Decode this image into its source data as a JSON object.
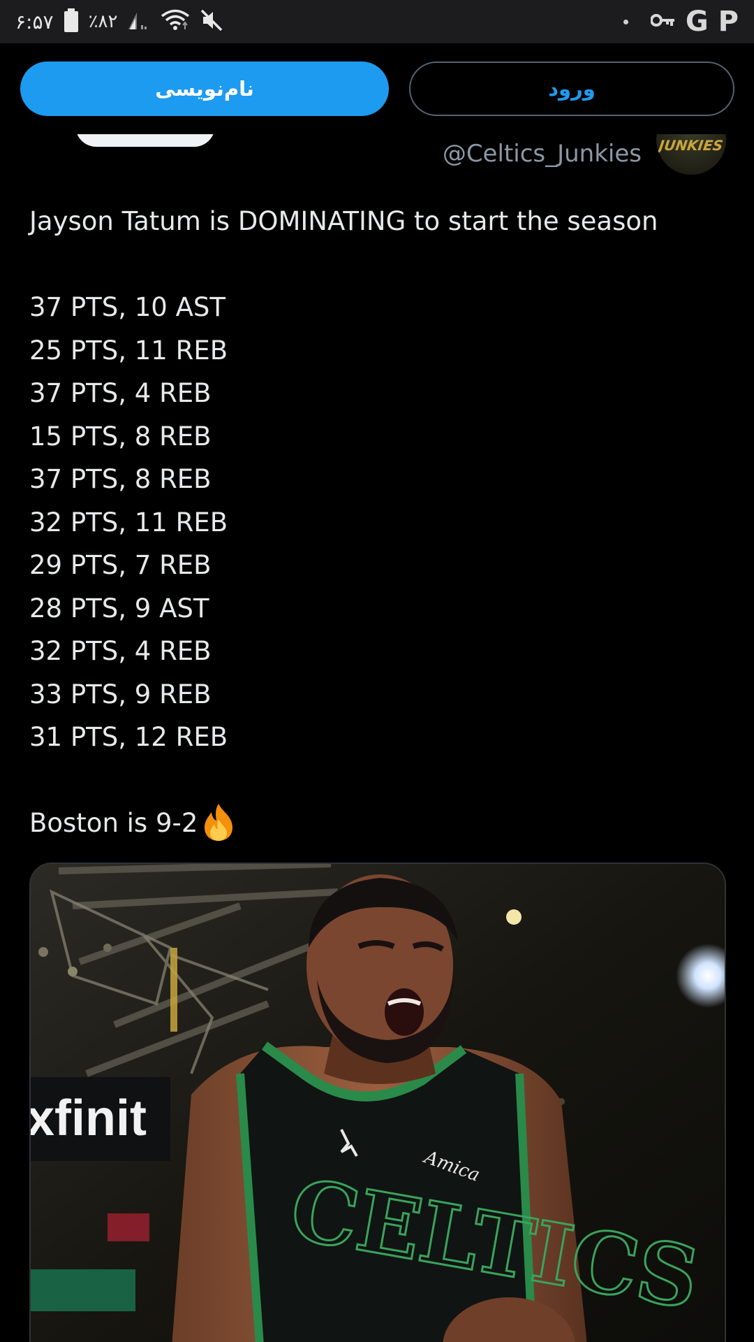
{
  "status_bar": {
    "time": "۶:۵۷",
    "battery_percent": "٪۸۲",
    "app_icons": [
      "key-icon",
      "g-letter-icon",
      "p-letter-icon"
    ],
    "g_letter": "G",
    "p_letter": "P"
  },
  "auth": {
    "signup_label": "نام‌نویسی",
    "login_label": "ورود"
  },
  "account": {
    "handle": "@Celtics_Junkies",
    "avatar_text": "JUNKIES"
  },
  "tweet": {
    "intro": "Jayson Tatum is DOMINATING to start the season",
    "stat_lines": [
      "37 PTS, 10 AST",
      "25 PTS, 11 REB",
      "37 PTS, 4 REB",
      "15 PTS, 8 REB",
      "37 PTS, 8 REB",
      "32 PTS, 11 REB",
      "29 PTS, 7 REB",
      "28 PTS, 9 AST",
      "32 PTS, 4 REB",
      "33 PTS, 9 REB",
      "31 PTS, 12 REB"
    ],
    "closing": "Boston is 9-2",
    "closing_emoji": "fire-emoji"
  },
  "media": {
    "arena_sign": "xfinit",
    "jersey_text": "CELTICS",
    "sponsor_patch": "Amica"
  },
  "colors": {
    "accent": "#1d9bf0",
    "background": "#000000",
    "text": "#e7e9ea",
    "secondary_text": "#8b98a5",
    "statusbar": "#1c1c1e"
  }
}
